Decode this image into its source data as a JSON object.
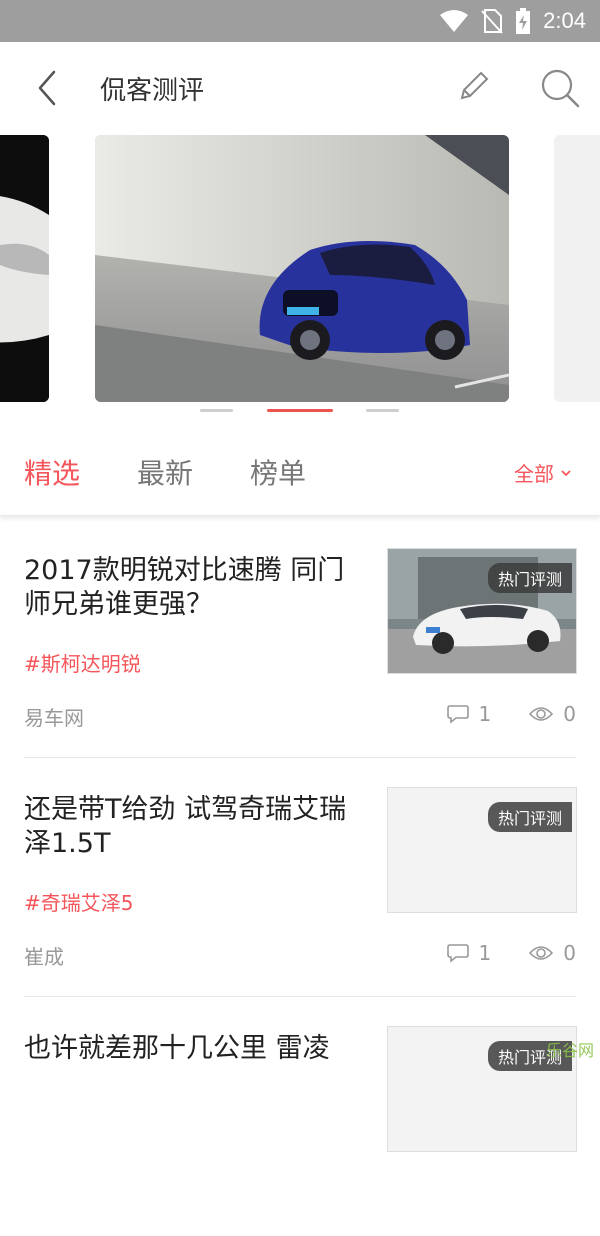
{
  "status_bar": {
    "time": "2:04",
    "icons": [
      "wifi-icon",
      "no-sim-icon",
      "battery-charging-icon"
    ]
  },
  "header": {
    "title": "侃客测评"
  },
  "carousel": {
    "active_index": 1,
    "slide_count": 3
  },
  "tabs": [
    {
      "label": "精选",
      "active": true
    },
    {
      "label": "最新",
      "active": false
    },
    {
      "label": "榜单",
      "active": false
    }
  ],
  "filter": {
    "label": "全部"
  },
  "articles": [
    {
      "title": "2017款明锐对比速腾 同门师兄弟谁更强？",
      "tag": "#斯柯达明锐",
      "source": "易车网",
      "badge": "热门评测",
      "comments": "1",
      "views": "0"
    },
    {
      "title": "还是带T给劲 试驾奇瑞艾瑞泽1.5T",
      "tag": "#奇瑞艾泽5",
      "source": "崔成",
      "badge": "热门评测",
      "comments": "1",
      "views": "0"
    },
    {
      "title": "也许就差那十几公里 雷凌",
      "badge": "热门评测"
    }
  ],
  "watermark": "乐谷网",
  "colors": {
    "accent": "#f4565b",
    "status_bar": "#9e9e9e"
  }
}
